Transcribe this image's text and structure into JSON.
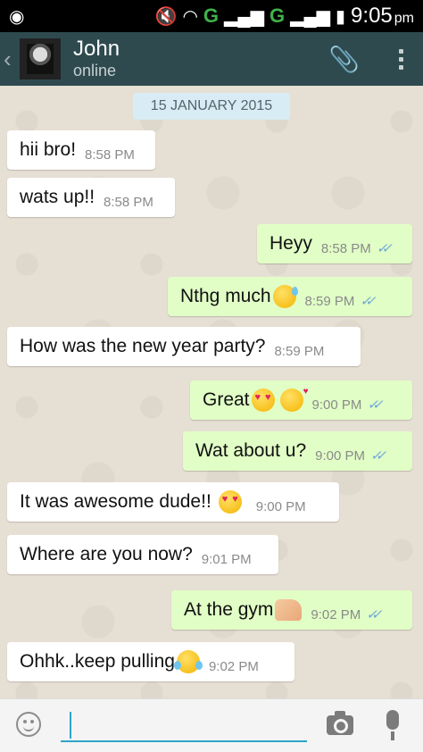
{
  "status_bar": {
    "time": "9:05",
    "ampm": "pm",
    "network1": "G",
    "network2": "G"
  },
  "header": {
    "contact_name": "John",
    "contact_status": "online"
  },
  "chat": {
    "date": "15 JANUARY 2015",
    "messages": [
      {
        "text": "hii bro!",
        "time": "8:58 PM",
        "direction": "in"
      },
      {
        "text": "wats up!!",
        "time": "8:58 PM",
        "direction": "in"
      },
      {
        "text": "Heyy",
        "time": "8:58 PM",
        "direction": "out",
        "status": "read"
      },
      {
        "text": "Nthg much",
        "emoji": "sweat-smile",
        "time": "8:59 PM",
        "direction": "out",
        "status": "read"
      },
      {
        "text": "How was the new year party?",
        "time": "8:59 PM",
        "direction": "in"
      },
      {
        "text": "Great",
        "emoji": "heart-eyes, kiss",
        "time": "9:00 PM",
        "direction": "out",
        "status": "read"
      },
      {
        "text": "Wat about u?",
        "time": "9:00 PM",
        "direction": "out",
        "status": "read"
      },
      {
        "text": "It was awesome dude!!",
        "emoji": "heart-eyes",
        "time": "9:00 PM",
        "direction": "in"
      },
      {
        "text": "Where are you now?",
        "time": "9:01 PM",
        "direction": "in"
      },
      {
        "text": "At the gym",
        "emoji": "flexed-biceps",
        "time": "9:02 PM",
        "direction": "out",
        "status": "read"
      },
      {
        "text": "Ohhk..keep pulling",
        "emoji": "tears-of-joy",
        "time": "9:02 PM",
        "direction": "in"
      }
    ]
  },
  "input_bar": {
    "value": "",
    "icons": [
      "smiley-icon",
      "camera-icon",
      "mic-icon"
    ]
  },
  "colors": {
    "header_bg": "#2e4a4f",
    "outgoing_bubble": "#e1fec6",
    "incoming_bubble": "#ffffff",
    "read_ticks": "#6aa6d8",
    "chat_bg": "#e6dfd3"
  }
}
